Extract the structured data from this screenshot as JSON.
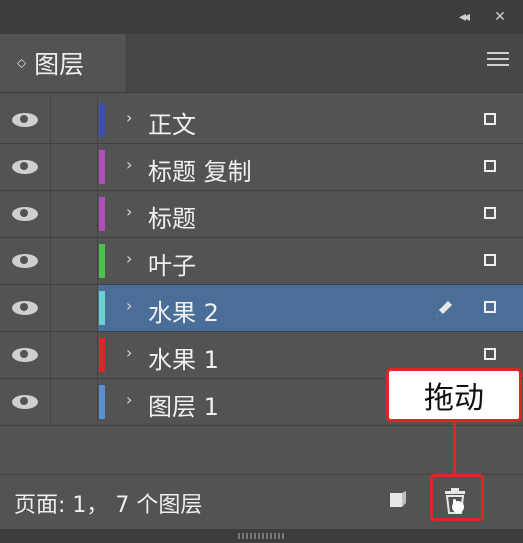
{
  "panel": {
    "tab_label": "图层",
    "tab_arrows": "◇"
  },
  "layers": [
    {
      "name": "正文",
      "color": "#3b4fb0",
      "selected": false
    },
    {
      "name": "标题 复制",
      "color": "#b04fb8",
      "selected": false
    },
    {
      "name": "标题",
      "color": "#b04fb8",
      "selected": false
    },
    {
      "name": "叶子",
      "color": "#4cc44c",
      "selected": false
    },
    {
      "name": "水果 2",
      "color": "#6cd0d0",
      "selected": true
    },
    {
      "name": "水果 1",
      "color": "#e0252a",
      "selected": false
    },
    {
      "name": "图层 1",
      "color": "#5a8fd6",
      "selected": false
    }
  ],
  "footer": {
    "status": "页面: 1， 7 个图层"
  },
  "annotation": {
    "text": "拖动",
    "color": "#e02525"
  }
}
